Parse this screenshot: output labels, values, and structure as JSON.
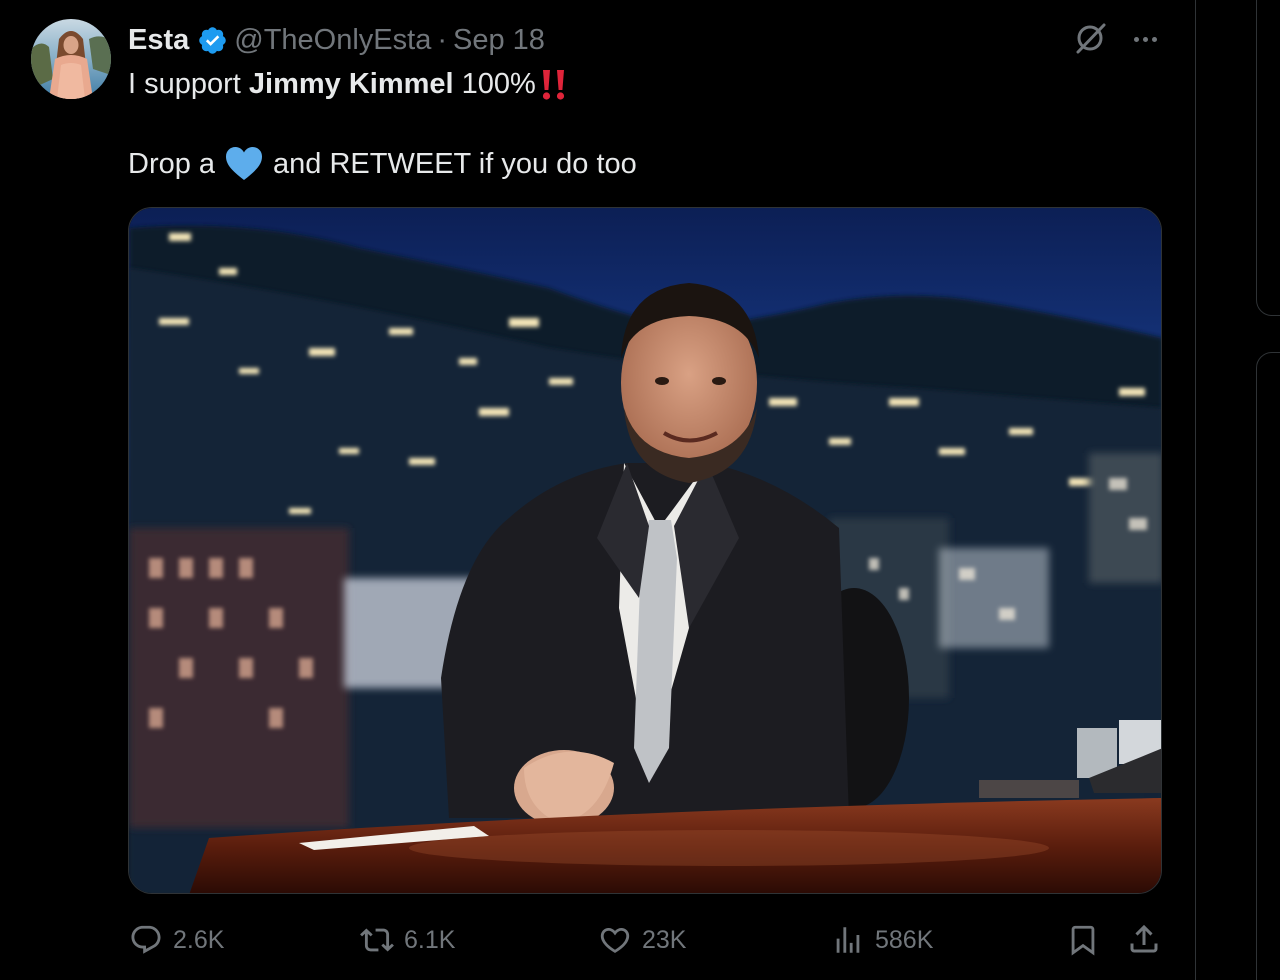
{
  "tweet": {
    "author": {
      "display_name": "Esta",
      "handle": "@TheOnlyEsta",
      "verified": true
    },
    "separator": "·",
    "timestamp": "Sep 18",
    "text": {
      "line1_prefix": "I support ",
      "line1_bold": "Jimmy Kimmel",
      "line1_suffix": " 100%",
      "line1_emoji": "double-exclamation-emoji",
      "line2_prefix": "Drop a",
      "line2_emoji": "blue-heart-emoji",
      "line2_suffix": "and RETWEET if you do too"
    },
    "media": {
      "type": "photo",
      "subject": "man in dark suit at talk-show desk with night city backdrop"
    },
    "actions": {
      "replies": "2.6K",
      "retweets": "6.1K",
      "likes": "23K",
      "views": "586K"
    }
  },
  "icons": {
    "verified": "verified-badge-icon",
    "grok": "grok-icon",
    "more": "more-icon",
    "reply": "reply-icon",
    "retweet": "retweet-icon",
    "like": "heart-icon",
    "views": "views-icon",
    "bookmark": "bookmark-icon",
    "share": "share-icon"
  },
  "colors": {
    "background": "#000000",
    "text_primary": "#e7e9ea",
    "text_secondary": "#71767b",
    "verified_blue": "#1d9bf0",
    "border": "#2f3336",
    "emoji_red": "#e0243a",
    "heart_blue": "#5dadec"
  }
}
